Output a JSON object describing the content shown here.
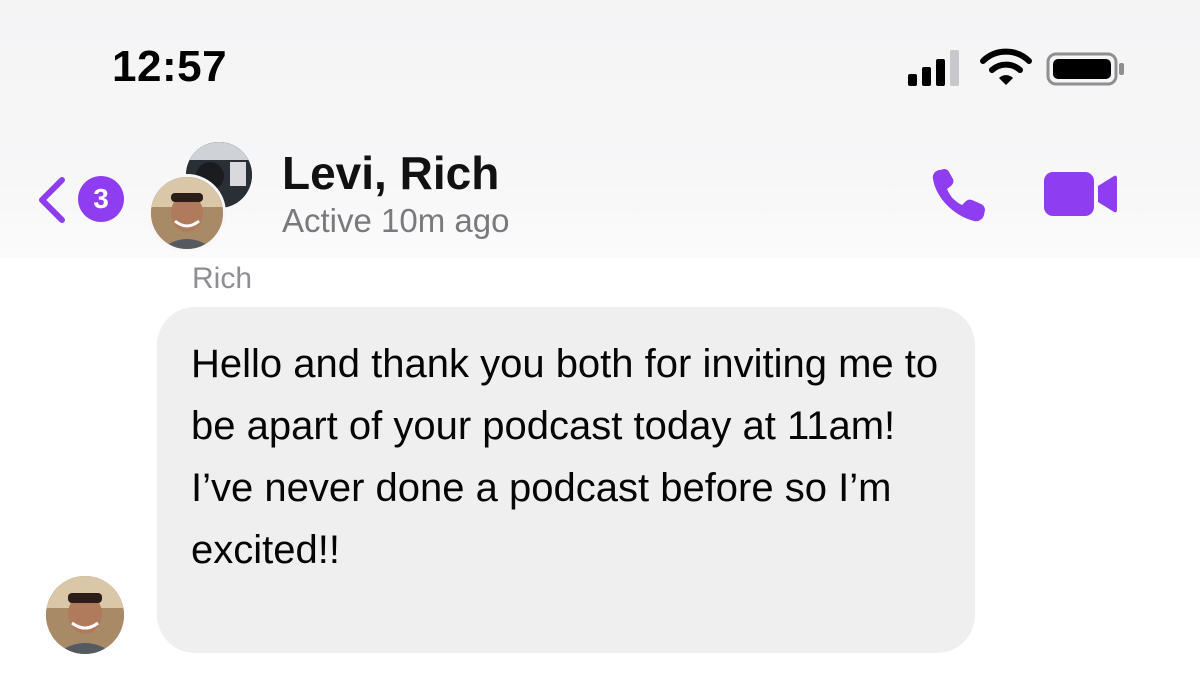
{
  "status_bar": {
    "time": "12:57",
    "icons": [
      "cellular-signal-icon",
      "wifi-icon",
      "battery-icon"
    ]
  },
  "header": {
    "back_icon": "chevron-left-icon",
    "unread_count": "3",
    "title": "Levi, Rich",
    "subtitle": "Active 10m ago",
    "call_icon": "phone-icon",
    "video_icon": "video-camera-icon"
  },
  "messages": [
    {
      "sender": "Rich",
      "text": "Hello and thank you both for inviting me to be apart of your podcast today at 11am! I’ve never done a podcast before so I’m excited!!"
    }
  ],
  "colors": {
    "accent": "#8f3df0",
    "bubble": "#efeff0",
    "muted_text": "#7a7a7e"
  }
}
